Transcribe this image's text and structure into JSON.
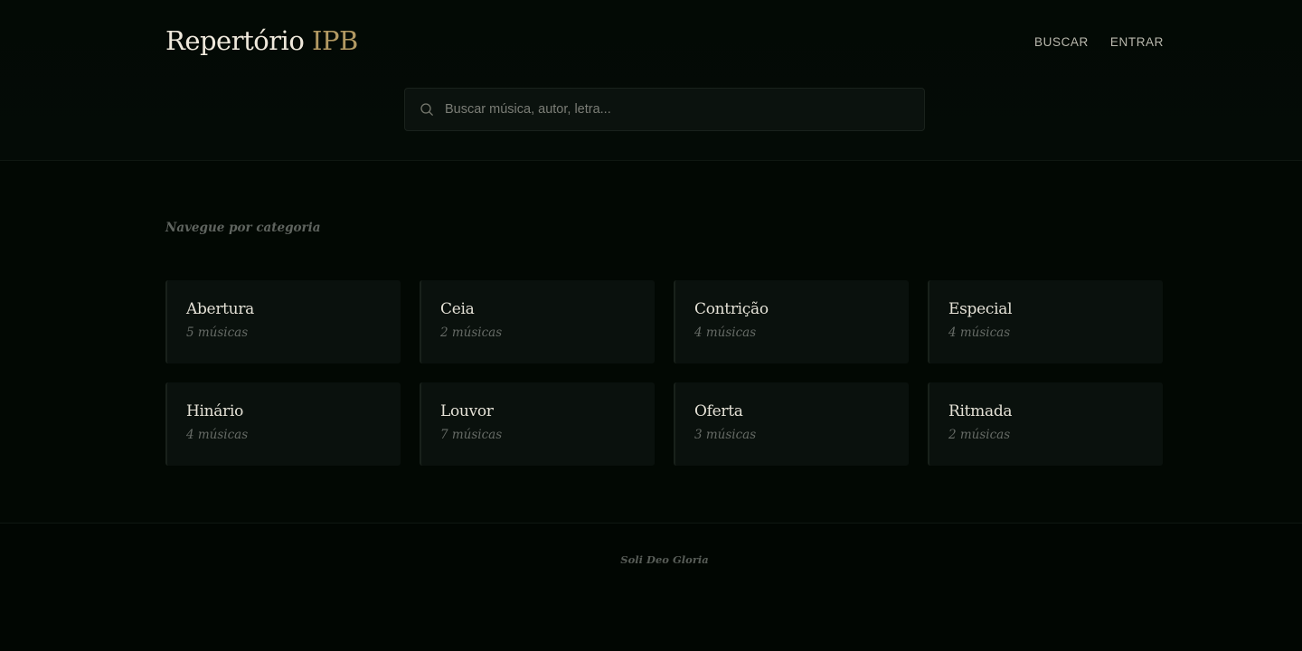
{
  "header": {
    "logo_main": "Repertório",
    "logo_accent": "IPB",
    "nav": [
      {
        "label": "BUSCAR"
      },
      {
        "label": "ENTRAR"
      }
    ]
  },
  "search": {
    "placeholder": "Buscar música, autor, letra...",
    "value": ""
  },
  "categories": {
    "title": "Navegue por categoria",
    "items": [
      {
        "name": "Abertura",
        "count": "5 músicas"
      },
      {
        "name": "Ceia",
        "count": "2 músicas"
      },
      {
        "name": "Contrição",
        "count": "4 músicas"
      },
      {
        "name": "Especial",
        "count": "4 músicas"
      },
      {
        "name": "Hinário",
        "count": "4 músicas"
      },
      {
        "name": "Louvor",
        "count": "7 músicas"
      },
      {
        "name": "Oferta",
        "count": "3 músicas"
      },
      {
        "name": "Ritmada",
        "count": "2 músicas"
      }
    ]
  },
  "footer": {
    "text": "Soli Deo Gloria"
  },
  "colors": {
    "background": "#020803",
    "accent": "#b39a63",
    "card": "#0a110d"
  },
  "icons": {
    "search": "search-icon"
  }
}
